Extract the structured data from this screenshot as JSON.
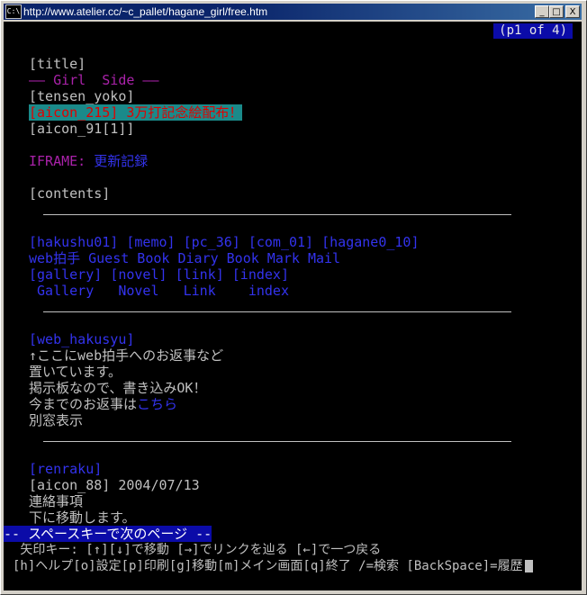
{
  "window": {
    "app_icon": "C:\\",
    "title": "http://www.atelier.cc/~c_pallet/hagane_girl/free.htm",
    "buttons": {
      "minimize": "_",
      "maximize": "□",
      "close": "X"
    }
  },
  "pager": "(p1 of 4)",
  "content": {
    "title": "[title]",
    "subtitle": "—— Girl  Side ——",
    "tensen": "[tensen_yoko]",
    "highlight_link": "[aicon_215] 3万打記念絵配布！",
    "aicon91": "[aicon_91[1]]",
    "iframe_label": "IFRAME:",
    "iframe_link": "更新記録",
    "contents": "[contents]",
    "nav1": [
      "[hakushu01]",
      "[memo]",
      "[pc_36]",
      "[com_01]",
      "[hagane0_10]"
    ],
    "nav2": [
      "web拍手",
      "Guest Book",
      "Diary",
      "Book Mark",
      "Mail"
    ],
    "nav3": [
      "[gallery]",
      "[novel]",
      "[link]",
      "[index]"
    ],
    "nav4": [
      "Gallery",
      "Novel",
      "Link",
      "index"
    ],
    "web_hakusyu": "[web_hakusyu]",
    "text1": "↑ここにweb拍手へのお返事など",
    "text2": "置いています。",
    "text3": "掲示板なので、書き込みOK！",
    "text4_prefix": "今までのお返事は",
    "text4_link": "こちら",
    "text5": "別窓表示",
    "renraku": "[renraku]",
    "aicon88": "[aicon_88] 2004/07/13",
    "text6": "連絡事項",
    "text7": "下に移動します。"
  },
  "status": {
    "prompt": "-- スペースキーで次のページ --",
    "help1": " 矢印キー: [↑][↓]で移動 [→]でリンクを辿る [←]で一つ戻る",
    "help2": "[h]ヘルプ[o]設定[p]印刷[g]移動[m]メイン画面[q]終了 /=検索 [BackSpace]=履歴"
  },
  "colors": {
    "link": "#3333ee",
    "visited_purple": "#aa22aa",
    "highlight_bg": "#1a8a8a",
    "status_bg": "#0b0ba8",
    "titlebar": "#0a246a"
  }
}
